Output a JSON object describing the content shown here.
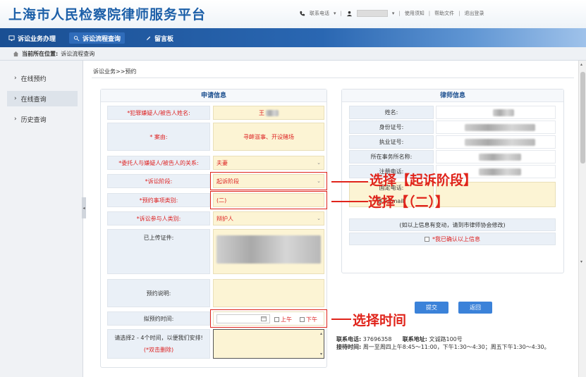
{
  "header": {
    "title": "上海市人民检察院律师服务平台",
    "contact_label": "联系电话",
    "usage_label": "使用须知",
    "help_label": "帮助文件",
    "logout_label": "退出登录"
  },
  "nav": {
    "items": [
      {
        "label": "诉讼业务办理",
        "icon": "monitor-icon"
      },
      {
        "label": "诉讼流程查询",
        "icon": "search-list-icon"
      },
      {
        "label": "留言板",
        "icon": "pencil-icon"
      }
    ],
    "active_index": 1
  },
  "location": {
    "label": "当前所在位置:",
    "value": "诉讼流程查询"
  },
  "sidebar": {
    "items": [
      {
        "label": "在线预约"
      },
      {
        "label": "在线查询"
      },
      {
        "label": "历史查询"
      }
    ],
    "active_index": 1
  },
  "main": {
    "breadcrumb": "诉讼业务>>预约"
  },
  "apply": {
    "title": "申请信息",
    "suspect_label": "*犯罪嫌疑人/被告人姓名:",
    "suspect_value": "王",
    "case_label": "* 案由:",
    "case_value": "寻衅滋事、开设赌场",
    "relation_label": "*委托人与嫌疑人/被告人的关系:",
    "relation_value": "夫妻",
    "stage_label": "*诉讼阶段:",
    "stage_value": "起诉阶段",
    "type_label": "*预约事项类别:",
    "type_value": "(二)",
    "participant_label": "*诉讼参与人类别:",
    "participant_value": "辩护人",
    "upload_label": "已上传证件:",
    "note_label": "预约说明:",
    "time_label": "拟预约时间:",
    "morning_label": "上午",
    "afternoon_label": "下午",
    "hint_text": "请选择2 - 4个时间，以便我们安排!",
    "hint_delete": "(*双击删除)"
  },
  "lawyer": {
    "title": "律师信息",
    "fields": [
      {
        "label": "姓名:"
      },
      {
        "label": "身份证号:"
      },
      {
        "label": "执业证号:"
      },
      {
        "label": "所在事务所名称:"
      },
      {
        "label": "注册电话:"
      },
      {
        "label": "固定电话:"
      },
      {
        "label": "联系Email:"
      }
    ],
    "change_note": "(如以上信息有变动，请到市律师协会修改)",
    "confirm_label": "*我已确认以上信息"
  },
  "buttons": {
    "submit": "提交",
    "back": "返回"
  },
  "contact": {
    "phone_label": "联系电话:",
    "phone": "37696358",
    "address_label": "联系地址:",
    "address": "文诚路100号",
    "hours_label": "接待时间:",
    "hours": "周一至周四上午8:45～11:00，下午1:30～4:30；周五下午1:30～4:30。"
  },
  "annotations": {
    "stage": "选择【起诉阶段】",
    "type": "选择【（二）】",
    "time": "选择时间"
  }
}
